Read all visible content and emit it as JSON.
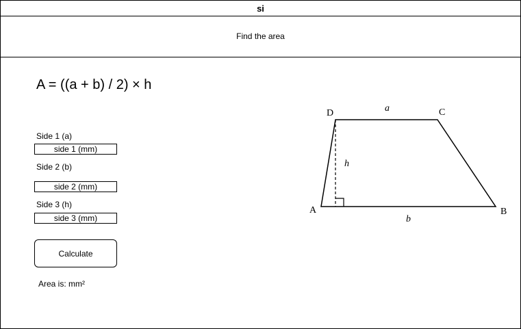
{
  "window": {
    "title": "si"
  },
  "header": {
    "instruction": "Find the area"
  },
  "formula": "A = ((a + b) / 2) × h",
  "form": {
    "side1_label": "Side 1 (a)",
    "side1_placeholder": "side 1 (mm)",
    "side2_label": "Side 2 (b)",
    "side2_placeholder": "side 2 (mm)",
    "side3_label": "Side 3 (h)",
    "side3_placeholder": "side 3 (mm)",
    "calculate_label": "Calculate"
  },
  "result": {
    "text": "Area is: mm²"
  },
  "diagram": {
    "vertex_a": "A",
    "vertex_b": "B",
    "vertex_c": "C",
    "vertex_d": "D",
    "side_a": "a",
    "side_b": "b",
    "height": "h"
  }
}
